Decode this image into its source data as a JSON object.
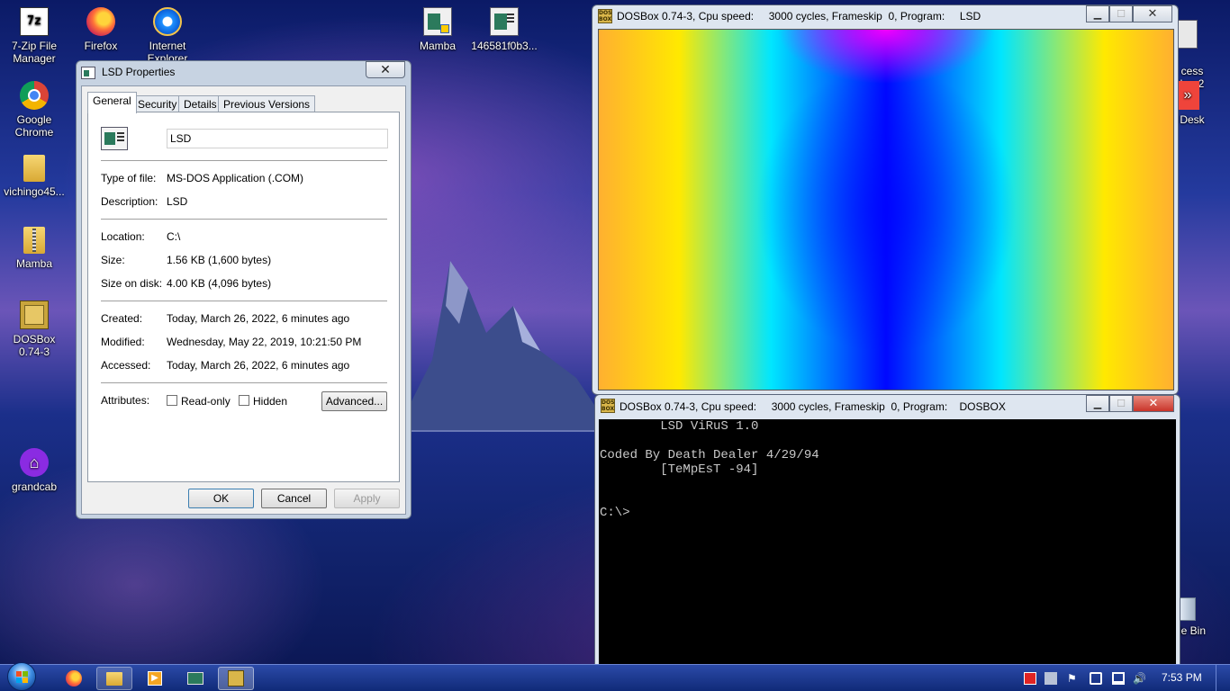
{
  "desktop": {
    "icons_left": [
      {
        "label": "7-Zip File Manager",
        "icon": "7zip-icon"
      },
      {
        "label": "Firefox",
        "icon": "firefox-icon"
      },
      {
        "label": "Internet Explorer",
        "icon": "ie-icon"
      },
      {
        "label": "Mamba",
        "icon": "program-icon"
      },
      {
        "label": "146581f0b3...",
        "icon": "program-icon"
      },
      {
        "label": "Google Chrome",
        "icon": "chrome-icon"
      },
      {
        "label": "vichingo45...",
        "icon": "folder-icon"
      },
      {
        "label": "Mamba",
        "icon": "zip-folder-icon"
      },
      {
        "label": "DOSBox 0.74-3",
        "icon": "dosbox-icon"
      },
      {
        "label": "grandcab",
        "icon": "gift-icon"
      }
    ],
    "icons_right": [
      {
        "label": "cess\nker 2",
        "icon": "app-icon"
      },
      {
        "label": "Desk",
        "icon": "anydesk-icon"
      },
      {
        "label": "le Bin",
        "icon": "recycle-bin-icon"
      }
    ]
  },
  "properties": {
    "title": "LSD Properties",
    "tabs": [
      "General",
      "Security",
      "Details",
      "Previous Versions"
    ],
    "name_value": "LSD",
    "rows": [
      {
        "label": "Type of file:",
        "value": "MS-DOS Application (.COM)"
      },
      {
        "label": "Description:",
        "value": "LSD"
      },
      {
        "label": "Location:",
        "value": "C:\\"
      },
      {
        "label": "Size:",
        "value": "1.56 KB (1,600 bytes)"
      },
      {
        "label": "Size on disk:",
        "value": "4.00 KB (4,096 bytes)"
      },
      {
        "label": "Created:",
        "value": "Today, March 26, 2022, 6 minutes ago"
      },
      {
        "label": "Modified:",
        "value": "Wednesday, May 22, 2019, 10:21:50 PM"
      },
      {
        "label": "Accessed:",
        "value": "Today, March 26, 2022, 6 minutes ago"
      }
    ],
    "attributes_label": "Attributes:",
    "readonly_label": "Read-only",
    "hidden_label": "Hidden",
    "advanced_label": "Advanced...",
    "ok_label": "OK",
    "cancel_label": "Cancel",
    "apply_label": "Apply"
  },
  "dosbox_top": {
    "title": "DOSBox 0.74-3, Cpu speed:     3000 cycles, Frameskip  0, Program:     LSD",
    "colors": {
      "left": "#ffb030",
      "mid": "#00e6ff",
      "center": "#0008ff",
      "top_center": "#f000ff"
    }
  },
  "dosbox_bottom": {
    "title": "DOSBox 0.74-3, Cpu speed:     3000 cycles, Frameskip  0, Program:    DOSBOX",
    "lines": [
      "        LSD ViRuS 1.0",
      "",
      "Coded By Death Dealer 4/29/94",
      "        [TeMpEsT -94]",
      "",
      "",
      "C:\\>"
    ]
  },
  "taskbar": {
    "clock": "7:53 PM",
    "pinned": [
      "start-orb-icon",
      "firefox-icon",
      "explorer-icon",
      "media-player-icon",
      "network-app-icon",
      "dosbox-icon"
    ]
  }
}
